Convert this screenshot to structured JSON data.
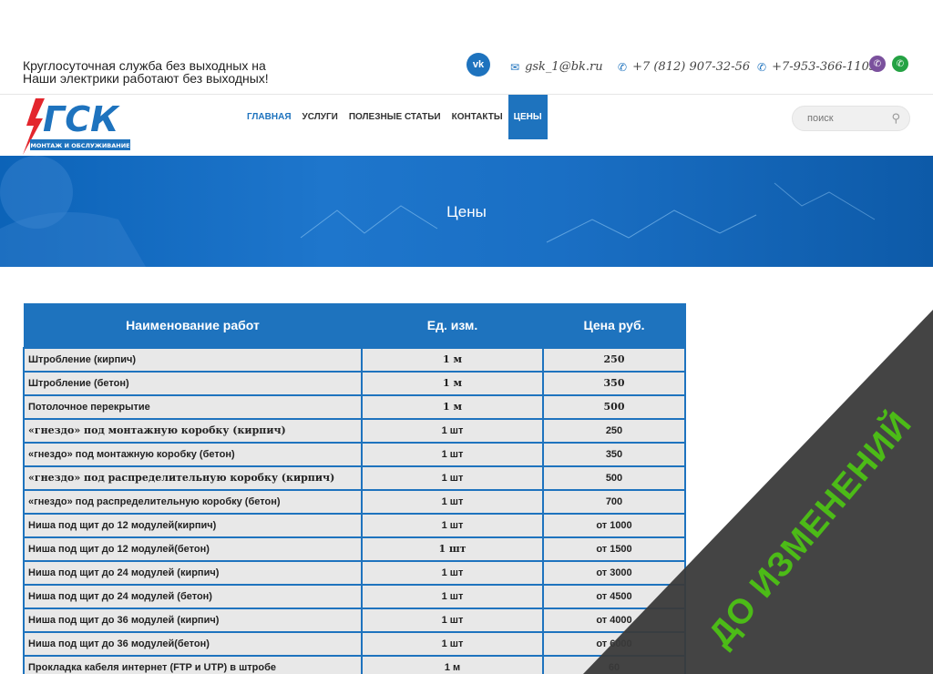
{
  "topbar": {
    "tagline_line1": "Круглосуточная служба без выходных на",
    "tagline_line2": "Наши электрики работают без выходных!",
    "vk_label": "vk",
    "email": "gsk_1@bk.ru",
    "phone1": "+7 (812) 907-32-56",
    "phone2": "+7-953-366-1103"
  },
  "logo": {
    "text": "ГСК",
    "subtitle": "МОНТАЖ И ОБСЛУЖИВАНИЕ"
  },
  "nav": {
    "items": [
      {
        "label": "Главная"
      },
      {
        "label": "Услуги"
      },
      {
        "label": "Полезные статьи"
      },
      {
        "label": "Контакты"
      },
      {
        "label": "Цены"
      }
    ]
  },
  "search": {
    "placeholder": "поиск"
  },
  "banner": {
    "title": "Цены"
  },
  "table": {
    "headers": [
      "Наименование работ",
      "Ед. изм.",
      "Цена руб."
    ],
    "rows": [
      {
        "name": "Штробление (кирпич)",
        "unit": "1 м",
        "price": "250"
      },
      {
        "name": "Штробление (бетон)",
        "unit": "1 м",
        "price": "350"
      },
      {
        "name": "Потолочное перекрытие",
        "unit": "1 м",
        "price": "500"
      },
      {
        "name": "«гнездо» под монтажную коробку (кирпич)",
        "unit": "1 шт",
        "price": "250"
      },
      {
        "name": "«гнездо» под монтажную коробку (бетон)",
        "unit": "1 шт",
        "price": "350"
      },
      {
        "name": "«гнездо» под распределительную коробку (кирпич)",
        "unit": "1 шт",
        "price": "500"
      },
      {
        "name": "«гнездо» под распределительную коробку (бетон)",
        "unit": "1 шт",
        "price": "700"
      },
      {
        "name": "Ниша под щит до 12 модулей(кирпич)",
        "unit": "1 шт",
        "price": "от 1000"
      },
      {
        "name": "Ниша под щит до 12 модулей(бетон)",
        "unit": "1 шт",
        "price": "от 1500"
      },
      {
        "name": "Ниша под щит до 24 модулей (кирпич)",
        "unit": "1 шт",
        "price": "от 3000"
      },
      {
        "name": "Ниша под щит до 24 модулей (бетон)",
        "unit": "1 шт",
        "price": "от 4500"
      },
      {
        "name": "Ниша под щит до 36 модулей (кирпич)",
        "unit": "1 шт",
        "price": "от 4000"
      },
      {
        "name": "Ниша под щит до 36 модулей(бетон)",
        "unit": "1 шт",
        "price": "от 6000"
      },
      {
        "name": "Прокладка кабеля интернет (FTP и UTP) в штробе",
        "unit": "1 м",
        "price": "60"
      }
    ]
  },
  "overlay": {
    "text": "ДО ИЗМЕНЕНИЙ",
    "color": "#4cbb17",
    "band_color": "#3a3a3a"
  },
  "colors": {
    "accent": "#1e73be"
  }
}
